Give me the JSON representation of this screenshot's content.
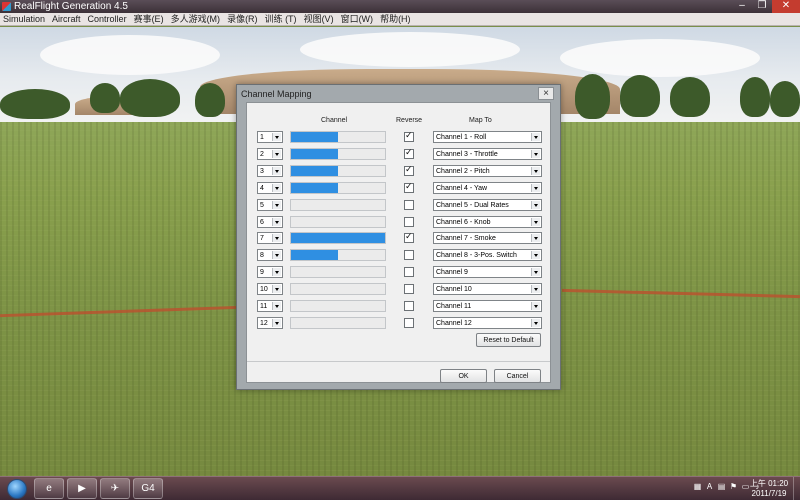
{
  "window": {
    "title": "RealFlight Generation 4.5",
    "controls": {
      "minimize": "–",
      "maximize": "❐",
      "close": "✕"
    }
  },
  "menu": [
    "Simulation",
    "Aircraft",
    "Controller",
    "赛事(E)",
    "多人游戏(M)",
    "录像(R)",
    "训练 (T)",
    "视图(V)",
    "窗口(W)",
    "帮助(H)"
  ],
  "dialog": {
    "title": "Channel Mapping",
    "close_label": "×",
    "headers": {
      "channel": "Channel",
      "reverse": "Reverse",
      "map_to": "Map To"
    },
    "rows": [
      {
        "num": "1",
        "level": 0.5,
        "reverse": true,
        "map": "Channel 1 - Roll"
      },
      {
        "num": "2",
        "level": 0.5,
        "reverse": true,
        "map": "Channel 3 - Throttle"
      },
      {
        "num": "3",
        "level": 0.5,
        "reverse": true,
        "map": "Channel 2 - Pitch"
      },
      {
        "num": "4",
        "level": 0.5,
        "reverse": true,
        "map": "Channel 4 - Yaw"
      },
      {
        "num": "5",
        "level": 0.0,
        "reverse": false,
        "map": "Channel 5 - Dual Rates"
      },
      {
        "num": "6",
        "level": 0.0,
        "reverse": false,
        "map": "Channel 6 - Knob"
      },
      {
        "num": "7",
        "level": 1.0,
        "reverse": true,
        "map": "Channel 7 - Smoke"
      },
      {
        "num": "8",
        "level": 0.5,
        "reverse": false,
        "map": "Channel 8 - 3-Pos. Switch"
      },
      {
        "num": "9",
        "level": 0.0,
        "reverse": false,
        "map": "Channel 9"
      },
      {
        "num": "10",
        "level": 0.0,
        "reverse": false,
        "map": "Channel 10"
      },
      {
        "num": "11",
        "level": 0.0,
        "reverse": false,
        "map": "Channel 11"
      },
      {
        "num": "12",
        "level": 0.0,
        "reverse": false,
        "map": "Channel 12"
      }
    ],
    "reset_label": "Reset to Default",
    "ok_label": "OK",
    "cancel_label": "Cancel"
  },
  "taskbar": {
    "apps": [
      "ie-icon",
      "media-player-icon",
      "realflight-icon",
      "g4-icon"
    ],
    "tray_icons": [
      "network-icon",
      "ime-icon",
      "keyboard-icon",
      "flag-icon",
      "monitor-icon",
      "volume-icon"
    ],
    "clock_time": "上午 01:20",
    "clock_date": "2011/7/19"
  },
  "colors": {
    "bar_fill": "#2f8fe2",
    "titlebar": "#3c3138",
    "dialog_frame": "#a3a9ad"
  }
}
